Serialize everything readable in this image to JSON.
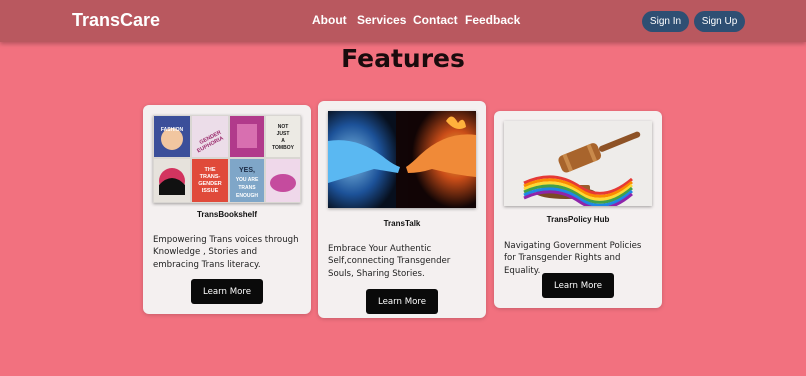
{
  "navbar": {
    "brand": "TransCare",
    "links": [
      "About",
      "Services",
      "Contact",
      "Feedback"
    ],
    "sign_in": "Sign In",
    "sign_up": "Sign Up"
  },
  "title": "Features",
  "cards": [
    {
      "title": "TransBookshelf",
      "description": "Empowering Trans voices through Knowledge , Stories and embracing Trans literacy.",
      "button": "Learn More",
      "image_icon": "books-collage-image",
      "book_texts": [
        "FASHION",
        "GENDER EUPHORIA",
        "NOT JUST A TOMBOY",
        "THE TRANS-GENDER ISSUE",
        "YES, YOU ARE TRANS ENOUGH"
      ]
    },
    {
      "title": "TransTalk",
      "description": "Embrace Your Authentic Self,connecting Transgender Souls, Sharing Stories.",
      "button": "Learn More",
      "image_icon": "fire-ice-hands-image"
    },
    {
      "title": "TransPolicy Hub",
      "description": "Navigating Government Policies for Transgender Rights and Equality.",
      "button": "Learn More",
      "image_icon": "gavel-rainbow-image"
    }
  ],
  "colors": {
    "page_background": "#f2717f",
    "navbar_background": "#b9585f",
    "pill_button": "#2e4f73",
    "card_background": "#f4f0f0",
    "learn_more_button": "#0a0a0a"
  }
}
